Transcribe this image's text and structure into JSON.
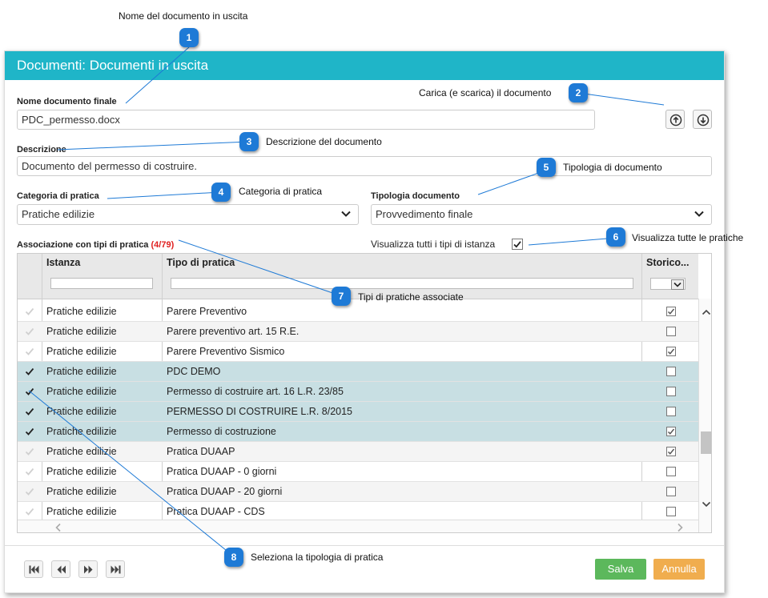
{
  "dialog": {
    "title": "Documenti: Documenti in uscita",
    "nome_label": "Nome documento finale",
    "nome_value": "PDC_permesso.docx",
    "upload_icon": "arrow-up-circle-icon",
    "download_icon": "arrow-down-circle-icon",
    "descrizione_label": "Descrizione",
    "descrizione_value": "Documento del permesso di costruire.",
    "categoria_label": "Categoria di pratica",
    "categoria_value": "Pratiche edilizie",
    "tipologia_label": "Tipologia documento",
    "tipologia_value": "Provvedimento finale",
    "assoc_label": "Associazione con tipi di pratica",
    "assoc_count": "(4/79)",
    "visualizza_label": "Visualizza tutti i tipi di istanza",
    "visualizza_checked": true
  },
  "grid": {
    "columns": [
      "Istanza",
      "Tipo di pratica",
      "Storico..."
    ],
    "rows": [
      {
        "istanza": "Pratiche edilizie",
        "tipo": "Parere Preventivo",
        "selected": false,
        "storico": true
      },
      {
        "istanza": "Pratiche edilizie",
        "tipo": "Parere preventivo art. 15 R.E.",
        "selected": false,
        "storico": false
      },
      {
        "istanza": "Pratiche edilizie",
        "tipo": "Parere Preventivo Sismico",
        "selected": false,
        "storico": true
      },
      {
        "istanza": "Pratiche edilizie",
        "tipo": "PDC DEMO",
        "selected": true,
        "storico": false
      },
      {
        "istanza": "Pratiche edilizie",
        "tipo": "Permesso di costruire art. 16 L.R. 23/85",
        "selected": true,
        "storico": false
      },
      {
        "istanza": "Pratiche edilizie",
        "tipo": "PERMESSO DI COSTRUIRE L.R. 8/2015",
        "selected": true,
        "storico": false
      },
      {
        "istanza": "Pratiche edilizie",
        "tipo": "Permesso di costruzione",
        "selected": true,
        "storico": true
      },
      {
        "istanza": "Pratiche edilizie",
        "tipo": "Pratica DUAAP",
        "selected": false,
        "storico": true
      },
      {
        "istanza": "Pratiche edilizie",
        "tipo": "Pratica DUAAP - 0 giorni",
        "selected": false,
        "storico": false
      },
      {
        "istanza": "Pratiche edilizie",
        "tipo": "Pratica DUAAP - 20 giorni",
        "selected": false,
        "storico": false
      },
      {
        "istanza": "Pratiche edilizie",
        "tipo": "Pratica DUAAP - CDS",
        "selected": false,
        "storico": false
      }
    ]
  },
  "footer": {
    "salva": "Salva",
    "annulla": "Annulla",
    "salva_color": "#5cb85c",
    "annulla_color": "#f0ad4e"
  },
  "callouts": [
    {
      "n": "1",
      "text": "Nome del documento in uscita"
    },
    {
      "n": "2",
      "text": "Carica (e scarica) il documento"
    },
    {
      "n": "3",
      "text": "Descrizione del documento"
    },
    {
      "n": "4",
      "text": "Categoria di pratica"
    },
    {
      "n": "5",
      "text": "Tipologia di documento"
    },
    {
      "n": "6",
      "text": "Visualizza tutte le pratiche"
    },
    {
      "n": "7",
      "text": "Tipi di pratiche associate"
    },
    {
      "n": "8",
      "text": "Seleziona la tipologia di pratica"
    }
  ],
  "colors": {
    "header": "#1fb5c8",
    "badge": "#1e7ad6",
    "selected_row": "#c8dfe3",
    "count": "#e02020"
  }
}
